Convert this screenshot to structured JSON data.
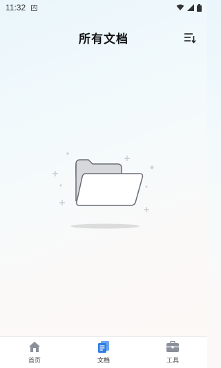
{
  "status_bar": {
    "time": "11:32",
    "notification_icon": "a-icon",
    "wifi_icon": "wifi-icon",
    "signal_icon": "signal-icon",
    "battery_icon": "battery-icon"
  },
  "header": {
    "title": "所有文档",
    "sort_icon": "sort-icon"
  },
  "empty_state": {
    "illustration": "open-folder-icon"
  },
  "tab_bar": {
    "items": [
      {
        "label": "首页",
        "icon": "home-icon",
        "active": false
      },
      {
        "label": "文档",
        "icon": "documents-icon",
        "active": true
      },
      {
        "label": "工具",
        "icon": "toolbox-icon",
        "active": false
      }
    ],
    "active_color": "#2f7de1",
    "inactive_color": "#8a8f99"
  }
}
